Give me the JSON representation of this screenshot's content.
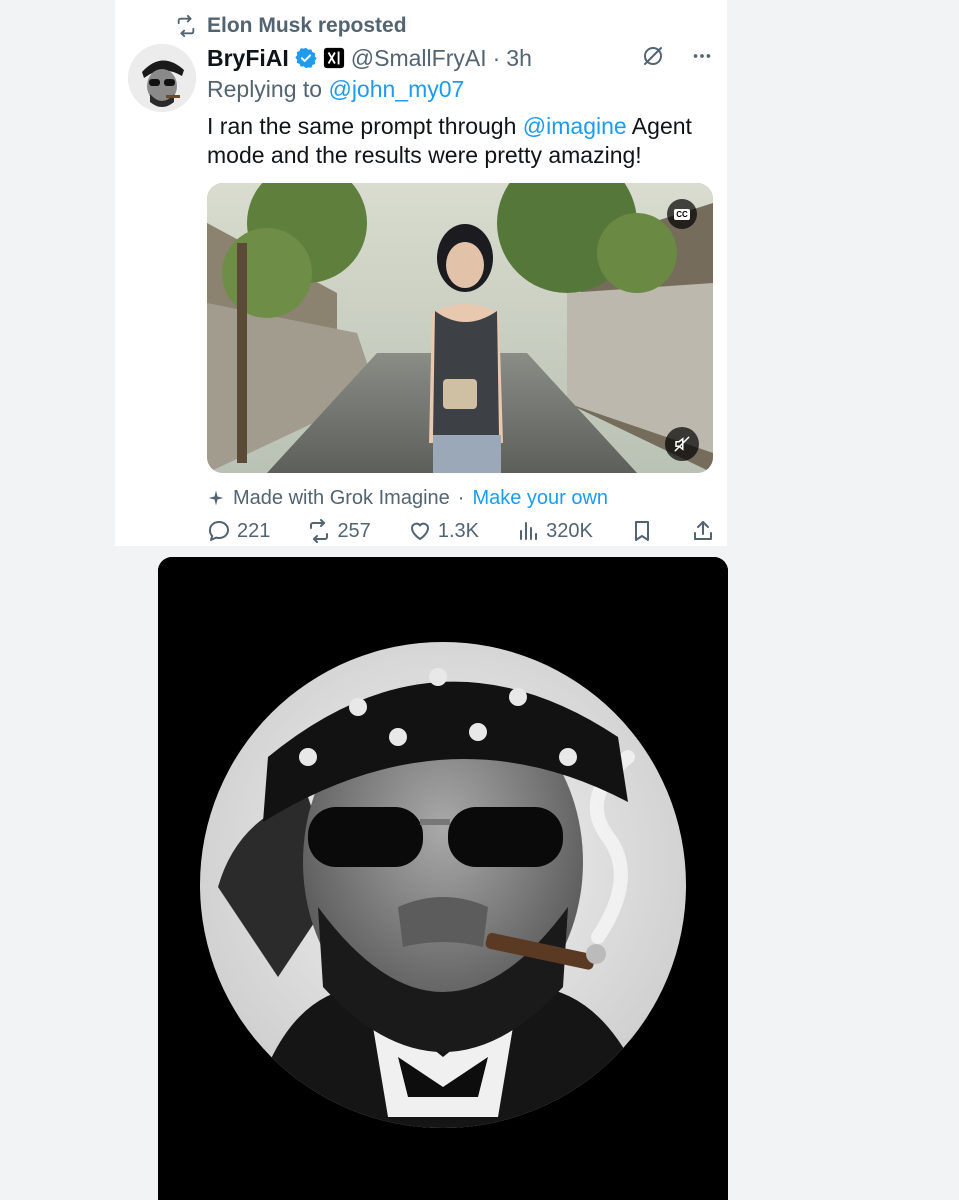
{
  "repost": {
    "text": "Elon Musk reposted",
    "icon": "repost-icon"
  },
  "author": {
    "display_name": "BryFiAI",
    "handle": "@SmallFryAI",
    "separator": "·",
    "time": "3h",
    "verified_color": "#1d9bf0"
  },
  "reply": {
    "prefix": "Replying to",
    "mention": "@john_my07"
  },
  "tweet": {
    "text_before": "I ran the same prompt through ",
    "mention": "@imagine",
    "text_after": " Agent mode and the results were pretty amazing!"
  },
  "media": {
    "cc_label": "CC"
  },
  "made_with": {
    "text": "Made with Grok Imagine",
    "separator": "·",
    "link": "Make your own"
  },
  "stats": {
    "replies": "221",
    "reposts": "257",
    "likes": "1.3K",
    "views": "320K"
  },
  "colors": {
    "accent": "#1d9bf0",
    "muted": "#536471",
    "text": "#0f1419"
  }
}
